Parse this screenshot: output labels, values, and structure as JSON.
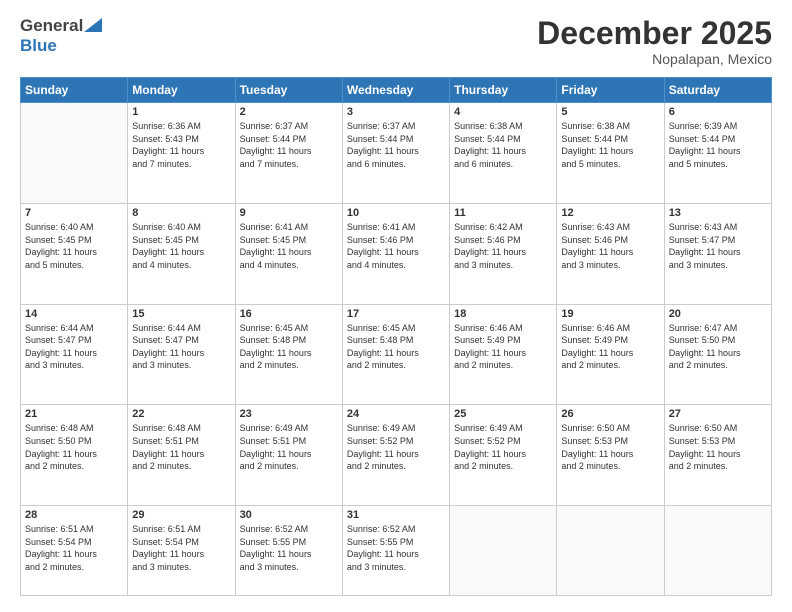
{
  "header": {
    "logo_general": "General",
    "logo_blue": "Blue",
    "month_title": "December 2025",
    "location": "Nopalapan, Mexico"
  },
  "days_of_week": [
    "Sunday",
    "Monday",
    "Tuesday",
    "Wednesday",
    "Thursday",
    "Friday",
    "Saturday"
  ],
  "weeks": [
    [
      {
        "day": "",
        "info": ""
      },
      {
        "day": "1",
        "info": "Sunrise: 6:36 AM\nSunset: 5:43 PM\nDaylight: 11 hours\nand 7 minutes."
      },
      {
        "day": "2",
        "info": "Sunrise: 6:37 AM\nSunset: 5:44 PM\nDaylight: 11 hours\nand 7 minutes."
      },
      {
        "day": "3",
        "info": "Sunrise: 6:37 AM\nSunset: 5:44 PM\nDaylight: 11 hours\nand 6 minutes."
      },
      {
        "day": "4",
        "info": "Sunrise: 6:38 AM\nSunset: 5:44 PM\nDaylight: 11 hours\nand 6 minutes."
      },
      {
        "day": "5",
        "info": "Sunrise: 6:38 AM\nSunset: 5:44 PM\nDaylight: 11 hours\nand 5 minutes."
      },
      {
        "day": "6",
        "info": "Sunrise: 6:39 AM\nSunset: 5:44 PM\nDaylight: 11 hours\nand 5 minutes."
      }
    ],
    [
      {
        "day": "7",
        "info": "Sunrise: 6:40 AM\nSunset: 5:45 PM\nDaylight: 11 hours\nand 5 minutes."
      },
      {
        "day": "8",
        "info": "Sunrise: 6:40 AM\nSunset: 5:45 PM\nDaylight: 11 hours\nand 4 minutes."
      },
      {
        "day": "9",
        "info": "Sunrise: 6:41 AM\nSunset: 5:45 PM\nDaylight: 11 hours\nand 4 minutes."
      },
      {
        "day": "10",
        "info": "Sunrise: 6:41 AM\nSunset: 5:46 PM\nDaylight: 11 hours\nand 4 minutes."
      },
      {
        "day": "11",
        "info": "Sunrise: 6:42 AM\nSunset: 5:46 PM\nDaylight: 11 hours\nand 3 minutes."
      },
      {
        "day": "12",
        "info": "Sunrise: 6:43 AM\nSunset: 5:46 PM\nDaylight: 11 hours\nand 3 minutes."
      },
      {
        "day": "13",
        "info": "Sunrise: 6:43 AM\nSunset: 5:47 PM\nDaylight: 11 hours\nand 3 minutes."
      }
    ],
    [
      {
        "day": "14",
        "info": "Sunrise: 6:44 AM\nSunset: 5:47 PM\nDaylight: 11 hours\nand 3 minutes."
      },
      {
        "day": "15",
        "info": "Sunrise: 6:44 AM\nSunset: 5:47 PM\nDaylight: 11 hours\nand 3 minutes."
      },
      {
        "day": "16",
        "info": "Sunrise: 6:45 AM\nSunset: 5:48 PM\nDaylight: 11 hours\nand 2 minutes."
      },
      {
        "day": "17",
        "info": "Sunrise: 6:45 AM\nSunset: 5:48 PM\nDaylight: 11 hours\nand 2 minutes."
      },
      {
        "day": "18",
        "info": "Sunrise: 6:46 AM\nSunset: 5:49 PM\nDaylight: 11 hours\nand 2 minutes."
      },
      {
        "day": "19",
        "info": "Sunrise: 6:46 AM\nSunset: 5:49 PM\nDaylight: 11 hours\nand 2 minutes."
      },
      {
        "day": "20",
        "info": "Sunrise: 6:47 AM\nSunset: 5:50 PM\nDaylight: 11 hours\nand 2 minutes."
      }
    ],
    [
      {
        "day": "21",
        "info": "Sunrise: 6:48 AM\nSunset: 5:50 PM\nDaylight: 11 hours\nand 2 minutes."
      },
      {
        "day": "22",
        "info": "Sunrise: 6:48 AM\nSunset: 5:51 PM\nDaylight: 11 hours\nand 2 minutes."
      },
      {
        "day": "23",
        "info": "Sunrise: 6:49 AM\nSunset: 5:51 PM\nDaylight: 11 hours\nand 2 minutes."
      },
      {
        "day": "24",
        "info": "Sunrise: 6:49 AM\nSunset: 5:52 PM\nDaylight: 11 hours\nand 2 minutes."
      },
      {
        "day": "25",
        "info": "Sunrise: 6:49 AM\nSunset: 5:52 PM\nDaylight: 11 hours\nand 2 minutes."
      },
      {
        "day": "26",
        "info": "Sunrise: 6:50 AM\nSunset: 5:53 PM\nDaylight: 11 hours\nand 2 minutes."
      },
      {
        "day": "27",
        "info": "Sunrise: 6:50 AM\nSunset: 5:53 PM\nDaylight: 11 hours\nand 2 minutes."
      }
    ],
    [
      {
        "day": "28",
        "info": "Sunrise: 6:51 AM\nSunset: 5:54 PM\nDaylight: 11 hours\nand 2 minutes."
      },
      {
        "day": "29",
        "info": "Sunrise: 6:51 AM\nSunset: 5:54 PM\nDaylight: 11 hours\nand 3 minutes."
      },
      {
        "day": "30",
        "info": "Sunrise: 6:52 AM\nSunset: 5:55 PM\nDaylight: 11 hours\nand 3 minutes."
      },
      {
        "day": "31",
        "info": "Sunrise: 6:52 AM\nSunset: 5:55 PM\nDaylight: 11 hours\nand 3 minutes."
      },
      {
        "day": "",
        "info": ""
      },
      {
        "day": "",
        "info": ""
      },
      {
        "day": "",
        "info": ""
      }
    ]
  ]
}
